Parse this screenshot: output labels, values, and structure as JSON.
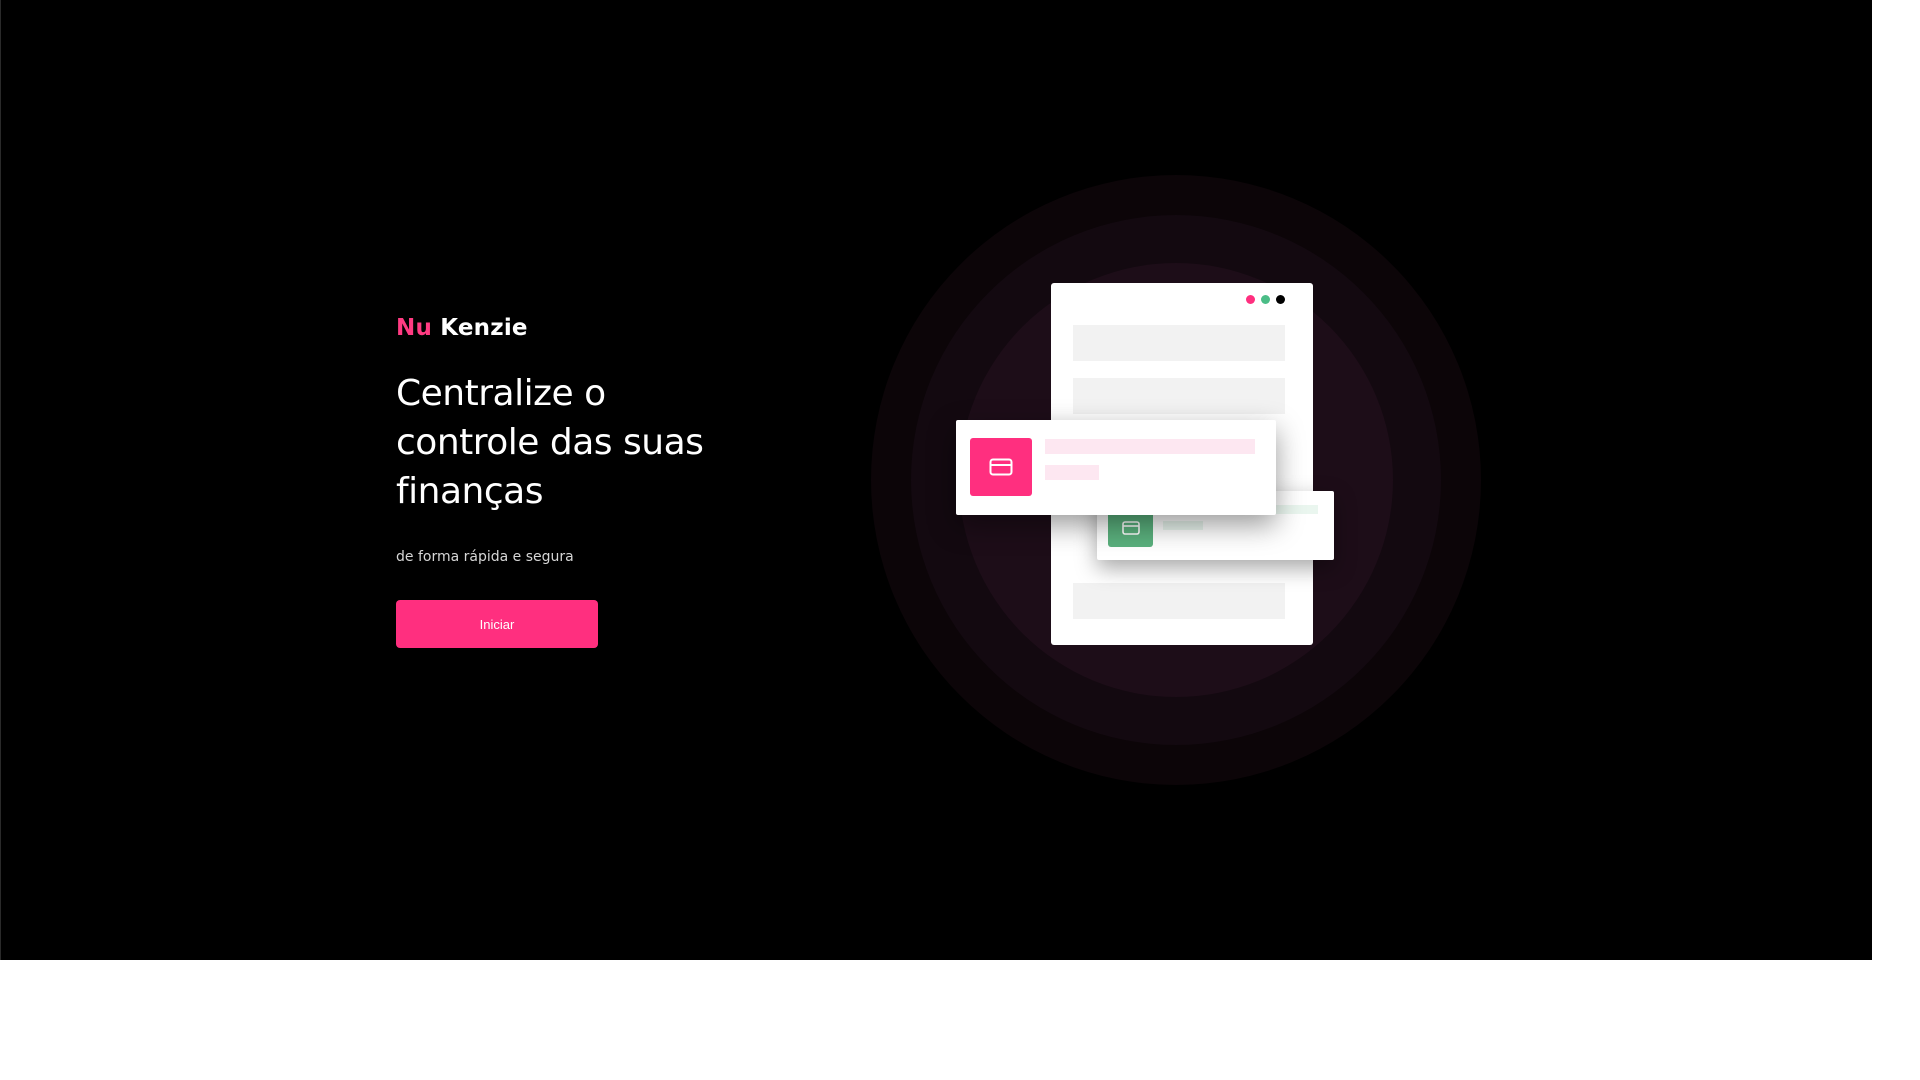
{
  "brand": {
    "nu": "Nu",
    "kenzie": "Kenzie"
  },
  "hero": {
    "headline": "Centralize o controle das suas finanças",
    "subtitle": "de forma rápida e segura",
    "cta_label": "Iniciar"
  },
  "colors": {
    "accent": "#ff2f7f",
    "success": "#5ab07d",
    "background": "#000000"
  },
  "illustration": {
    "status_dots": [
      "pink",
      "green",
      "black"
    ],
    "cards": [
      {
        "color": "pink",
        "icon": "card-icon"
      },
      {
        "color": "green",
        "icon": "card-icon"
      }
    ]
  }
}
